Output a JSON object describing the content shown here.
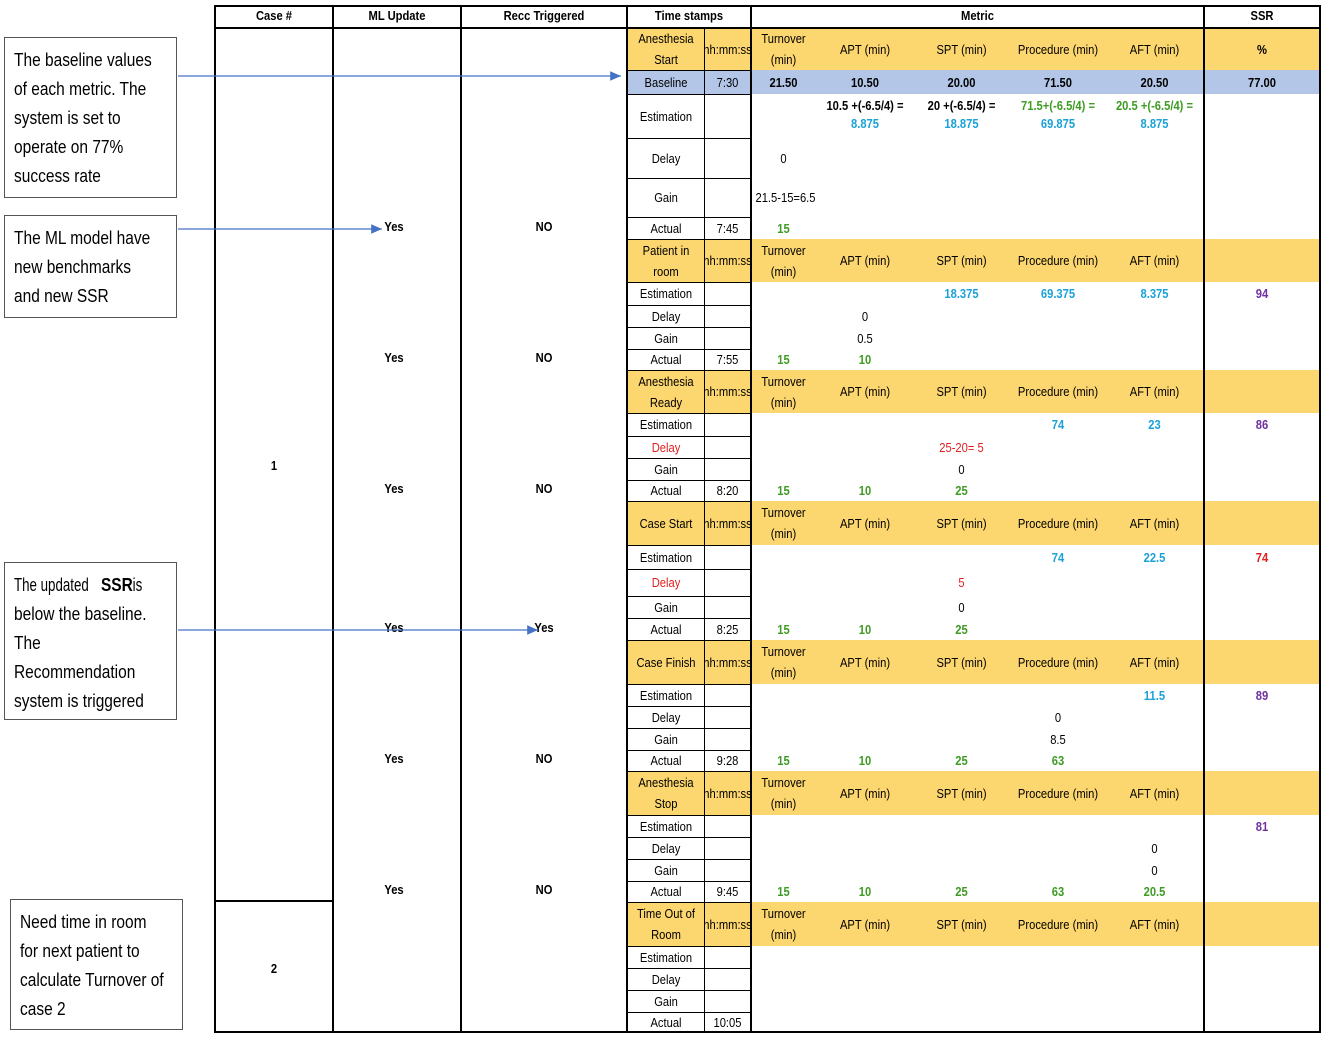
{
  "headers": {
    "case": "Case #",
    "ml_update": "ML Update",
    "recc": "Recc Triggered",
    "timestamps": "Time stamps",
    "metric": "Metric",
    "ssr": "SSR"
  },
  "hhmmss": "hh:mm:ss",
  "metric_cols": [
    "Turnover (min)",
    "APT (min)",
    "SPT (min)",
    "Procedure (min)",
    "AFT (min)"
  ],
  "case_numbers": [
    "1",
    "2"
  ],
  "row_labels": {
    "baseline": "Baseline",
    "estimation": "Estimation",
    "delay": "Delay",
    "gain": "Gain",
    "actual": "Actual"
  },
  "phases": [
    {
      "name": "Anesthesia Start",
      "actual_time": "7:45",
      "ml": "Yes",
      "recc": "NO"
    },
    {
      "name": "Patient in room",
      "actual_time": "7:55",
      "ml": "Yes",
      "recc": "NO"
    },
    {
      "name": "Anesthesia Ready",
      "actual_time": "8:20",
      "ml": "Yes",
      "recc": "NO"
    },
    {
      "name": "Case Start",
      "actual_time": "8:25",
      "ml": "Yes",
      "recc": "Yes"
    },
    {
      "name": "Case Finish",
      "actual_time": "9:28",
      "ml": "Yes",
      "recc": "NO"
    },
    {
      "name": "Anesthesia Stop",
      "actual_time": "9:45",
      "ml": "Yes",
      "recc": "NO"
    },
    {
      "name": "Time Out of Room",
      "actual_time": "10:05"
    }
  ],
  "baseline": {
    "time": "7:30",
    "turnover": "21.50",
    "apt": "10.50",
    "spt": "20.00",
    "procedure": "71.50",
    "aft": "20.50",
    "ssr": "77.00",
    "ssr_unit": "%"
  },
  "p1": {
    "est_apt_formula": "10.5 +(-6.5/4) =",
    "est_apt": "8.875",
    "est_spt_formula": "20 +(-6.5/4) =",
    "est_spt": "18.875",
    "est_proc_formula": "71.5+(-6.5/4) =",
    "est_proc": "69.875",
    "est_aft_formula": "20.5 +(-6.5/4) =",
    "est_aft": "8.875",
    "delay_turnover": "0",
    "gain_turnover": "21.5-15=6.5",
    "actual_turnover": "15"
  },
  "p2": {
    "est_spt": "18.375",
    "est_proc": "69.375",
    "est_aft": "8.375",
    "ssr": "94",
    "delay_apt": "0",
    "gain_apt": "0.5",
    "actual_turnover": "15",
    "actual_apt": "10"
  },
  "p3": {
    "est_proc": "74",
    "est_aft": "23",
    "ssr": "86",
    "delay_spt": "25-20= 5",
    "gain_spt": "0",
    "actual_turnover": "15",
    "actual_apt": "10",
    "actual_spt": "25"
  },
  "p4": {
    "est_proc": "74",
    "est_aft": "22.5",
    "ssr": "74",
    "delay_spt": "5",
    "gain_spt": "0",
    "actual_turnover": "15",
    "actual_apt": "10",
    "actual_spt": "25"
  },
  "p5": {
    "est_aft": "11.5",
    "ssr": "89",
    "delay_proc": "0",
    "gain_proc": "8.5",
    "actual_turnover": "15",
    "actual_apt": "10",
    "actual_spt": "25",
    "actual_proc": "63"
  },
  "p6": {
    "ssr": "81",
    "delay_aft": "0",
    "gain_aft": "0",
    "actual_turnover": "15",
    "actual_apt": "10",
    "actual_spt": "25",
    "actual_proc": "63",
    "actual_aft": "20.5"
  },
  "callouts": {
    "baseline": [
      "The baseline values",
      "of each metric. The",
      "system is set to",
      "operate on 77%",
      "success rate"
    ],
    "ml_model": [
      "The ML model have",
      "new benchmarks",
      "and  new SSR"
    ],
    "ssr_below_pre": "The updated ",
    "ssr_below_bold": "SSR",
    "ssr_below_post": " is",
    "ssr_below_rest": [
      "below the baseline.",
      "The",
      "Recommendation",
      "system is triggered"
    ],
    "next_patient": [
      "Need time in room",
      "for next patient to",
      "calculate Turnover of",
      "case 2"
    ]
  },
  "colors": {
    "header_fill": "#fcd66e",
    "baseline_fill": "#b4c6e7",
    "actual_green": "#3e9b23",
    "estimate_cyan": "#1aa2d8",
    "delay_red": "#e02020",
    "ssr_purple": "#7030a0",
    "arrow_blue": "#4472c4"
  }
}
